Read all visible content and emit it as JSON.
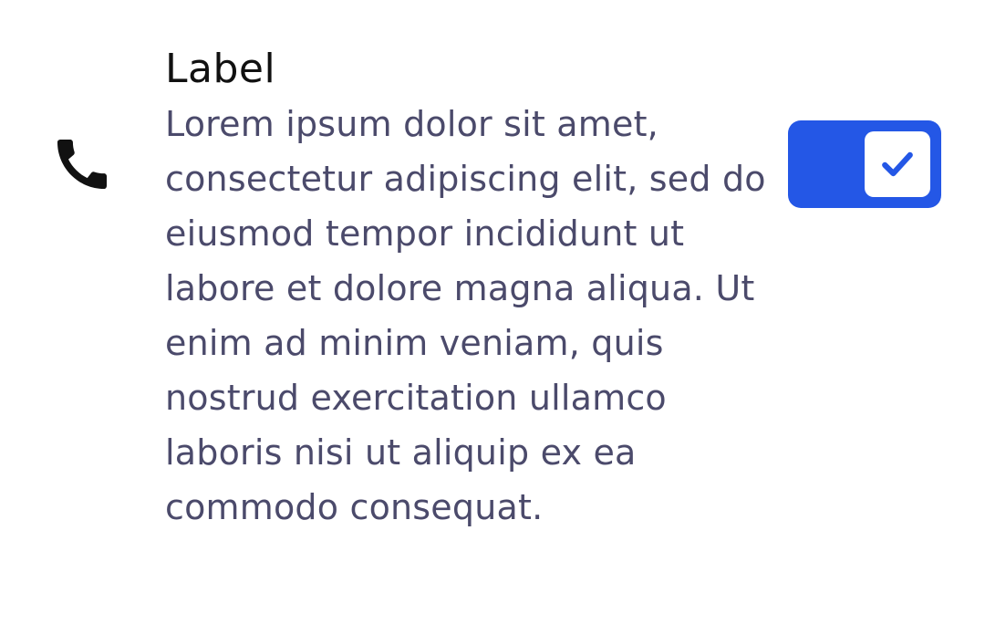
{
  "list_item": {
    "leading_icon": "phone-icon",
    "label": "Label",
    "description": "Lorem ipsum dolor sit amet, consectetur adipiscing elit, sed do eiusmod tempor incididunt ut labore et dolore magna aliqua. Ut enim ad minim veniam, quis nostrud exercitation ullamco laboris nisi ut aliquip ex ea commodo consequat.",
    "toggle": {
      "checked": true,
      "thumb_icon": "check-icon",
      "accent_color": "#2457e6"
    }
  },
  "colors": {
    "label": "#111111",
    "description": "#4b4a6b",
    "background": "#ffffff"
  }
}
